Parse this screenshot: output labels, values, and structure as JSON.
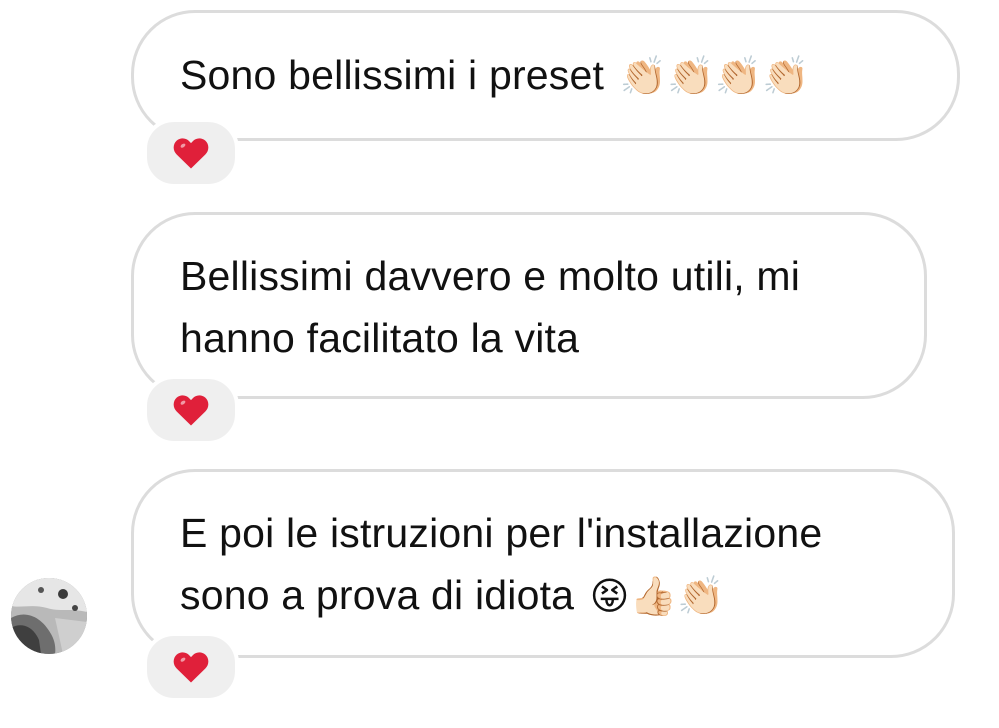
{
  "messages": [
    {
      "text": "Sono bellissimi i preset",
      "emoji": "👏🏻👏🏻👏🏻👏🏻",
      "reaction": "heart-icon"
    },
    {
      "line1": "Bellissimi davvero e molto utili, mi",
      "line2": "hanno facilitato la vita",
      "reaction": "heart-icon"
    },
    {
      "line1": "E poi le istruzioni per l'installazione",
      "line2": "sono a prova di idiota",
      "emoji": "😝👍🏻👏🏻",
      "reaction": "heart-icon",
      "has_avatar": true
    }
  ],
  "colors": {
    "bubble_border": "#dcdcdc",
    "reaction_bg": "#efefef",
    "heart": "#e0203a"
  }
}
